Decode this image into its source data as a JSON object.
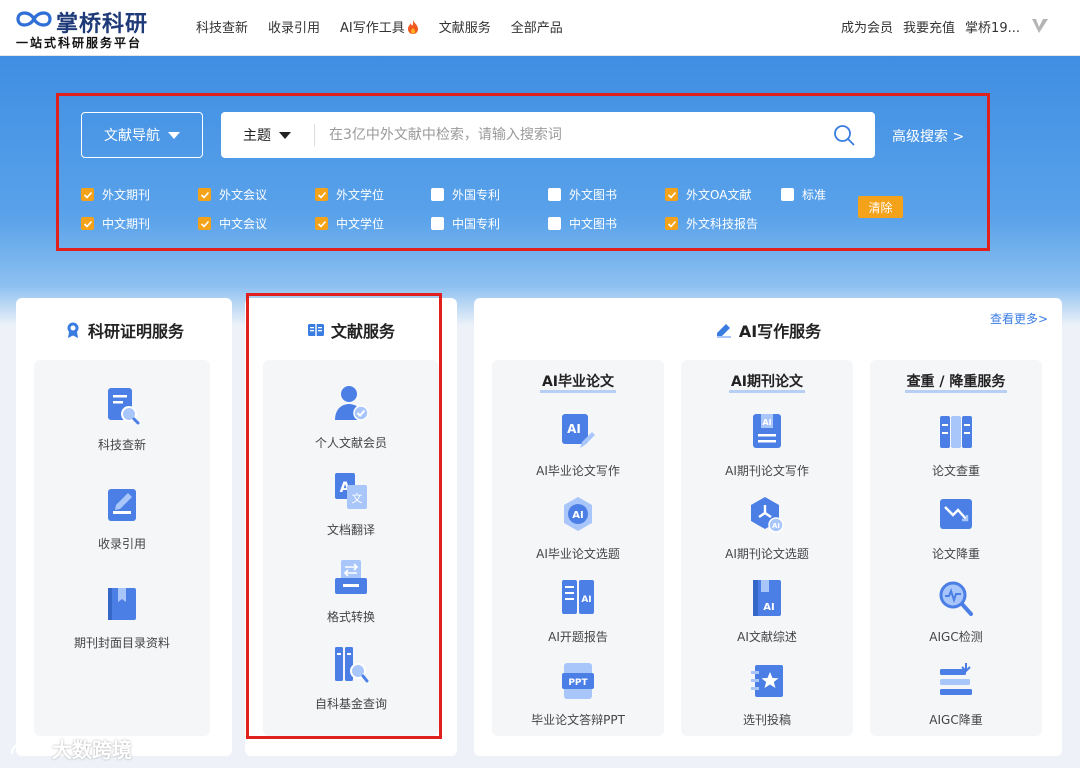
{
  "brand": {
    "name": "掌桥科研",
    "slogan": "一站式科研服务平台"
  },
  "nav": [
    {
      "label": "科技查新"
    },
    {
      "label": "收录引用"
    },
    {
      "label": "AI写作工具",
      "icon": "fire-icon"
    },
    {
      "label": "文献服务"
    },
    {
      "label": "全部产品"
    }
  ],
  "user_links": {
    "member": "成为会员",
    "recharge": "我要充值",
    "username": "掌桥19..."
  },
  "search": {
    "nav_button": "文献导航",
    "type_label": "主题",
    "placeholder": "在3亿中外文献中检索，请输入搜索词",
    "advanced": "高级搜索 >",
    "clear": "清除"
  },
  "filters": {
    "row1": [
      {
        "label": "外文期刊",
        "checked": true
      },
      {
        "label": "外文会议",
        "checked": true
      },
      {
        "label": "外文学位",
        "checked": true
      },
      {
        "label": "外国专利",
        "checked": false
      },
      {
        "label": "外文图书",
        "checked": false
      },
      {
        "label": "外文OA文献",
        "checked": true
      },
      {
        "label": "标准",
        "checked": false
      }
    ],
    "row2": [
      {
        "label": "中文期刊",
        "checked": true
      },
      {
        "label": "中文会议",
        "checked": true
      },
      {
        "label": "中文学位",
        "checked": true
      },
      {
        "label": "中国专利",
        "checked": false
      },
      {
        "label": "中文图书",
        "checked": false
      },
      {
        "label": "外文科技报告",
        "checked": true
      }
    ]
  },
  "research_proof": {
    "title": "科研证明服务",
    "items": [
      {
        "label": "科技查新",
        "icon": "document-search-icon"
      },
      {
        "label": "收录引用",
        "icon": "edit-document-icon"
      },
      {
        "label": "期刊封面目录资料",
        "icon": "book-icon"
      }
    ]
  },
  "literature": {
    "title": "文献服务",
    "items": [
      {
        "label": "个人文献会员",
        "icon": "user-check-icon"
      },
      {
        "label": "文档翻译",
        "icon": "translate-icon"
      },
      {
        "label": "格式转换",
        "icon": "format-convert-icon"
      },
      {
        "label": "自科基金查询",
        "icon": "fund-search-icon"
      }
    ]
  },
  "ai_writing": {
    "title": "AI写作服务",
    "more": "查看更多>",
    "columns": [
      {
        "title": "AI毕业论文",
        "items": [
          {
            "label": "AI毕业论文写作",
            "icon": "ai-write-icon"
          },
          {
            "label": "AI毕业论文选题",
            "icon": "ai-badge-icon"
          },
          {
            "label": "AI开题报告",
            "icon": "ai-report-icon"
          },
          {
            "label": "毕业论文答辩PPT",
            "icon": "ppt-icon"
          }
        ]
      },
      {
        "title": "AI期刊论文",
        "items": [
          {
            "label": "AI期刊论文写作",
            "icon": "ai-journal-icon"
          },
          {
            "label": "AI期刊论文选题",
            "icon": "ai-hex-icon"
          },
          {
            "label": "AI文献综述",
            "icon": "ai-review-icon"
          },
          {
            "label": "选刊投稿",
            "icon": "star-submit-icon"
          }
        ]
      },
      {
        "title": "查重 / 降重服务",
        "items": [
          {
            "label": "论文查重",
            "icon": "plagiarism-check-icon"
          },
          {
            "label": "论文降重",
            "icon": "reduce-duplicate-icon"
          },
          {
            "label": "AIGC检测",
            "icon": "aigc-detect-icon"
          },
          {
            "label": "AIGC降重",
            "icon": "aigc-reduce-icon"
          }
        ]
      }
    ]
  },
  "watermark": "大数跨境",
  "colors": {
    "accent": "#3a7de0",
    "banner": "#3f8ee3",
    "checkbox": "#f4a21a",
    "highlight": "#e0201c"
  }
}
